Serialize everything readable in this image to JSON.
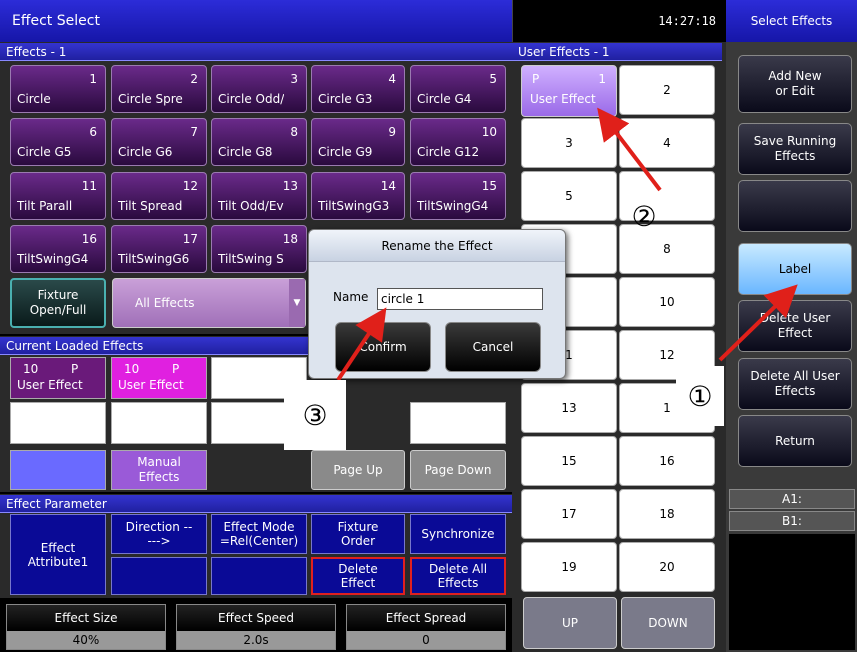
{
  "header": {
    "title": "Effect Select",
    "clock": "14:27:18",
    "mode": "Select Effects"
  },
  "effects_panel": {
    "title": "Effects - 1",
    "items": [
      {
        "num": "1",
        "name": "Circle"
      },
      {
        "num": "2",
        "name": "Circle Spre"
      },
      {
        "num": "3",
        "name": "Circle Odd/"
      },
      {
        "num": "4",
        "name": "Circle G3"
      },
      {
        "num": "5",
        "name": "Circle G4"
      },
      {
        "num": "6",
        "name": "Circle G5"
      },
      {
        "num": "7",
        "name": "Circle G6"
      },
      {
        "num": "8",
        "name": "Circle G8"
      },
      {
        "num": "9",
        "name": "Circle G9"
      },
      {
        "num": "10",
        "name": "Circle G12"
      },
      {
        "num": "11",
        "name": "Tilt Parall"
      },
      {
        "num": "12",
        "name": "Tilt Spread"
      },
      {
        "num": "13",
        "name": "Tilt Odd/Ev"
      },
      {
        "num": "14",
        "name": "TiltSwingG3"
      },
      {
        "num": "15",
        "name": "TiltSwingG4"
      },
      {
        "num": "16",
        "name": "TiltSwingG4"
      },
      {
        "num": "17",
        "name": "TiltSwingG6"
      },
      {
        "num": "18",
        "name": "TiltSwing S"
      }
    ],
    "fixture_btn": "Fixture Open/Full",
    "filter_value": "All Effects"
  },
  "loaded_panel": {
    "title": "Current Loaded Effects",
    "cells": [
      {
        "num": "10",
        "tag": "P",
        "name": "User Effect"
      },
      {
        "num": "10",
        "tag": "P",
        "name": "User Effect"
      }
    ],
    "manual_label": "Manual Effects",
    "page_up": "Page Up",
    "page_down": "Page Down"
  },
  "param_panel": {
    "title": "Effect Parameter",
    "attribute": "Effect Attribute1",
    "direction": "Direction ----->",
    "mode": "Effect Mode =Rel(Center)",
    "order": "Fixture Order",
    "sync": "Synchronize",
    "delete": "Delete Effect",
    "delete_all": "Delete All Effects"
  },
  "bottom": [
    {
      "label": "Effect Size",
      "value": "40%"
    },
    {
      "label": "Effect Speed",
      "value": "2.0s"
    },
    {
      "label": "Effect Spread",
      "value": "0"
    }
  ],
  "user_effects": {
    "title": "User Effects - 1",
    "first": {
      "tag": "P",
      "num": "1",
      "name": "User Effect"
    },
    "cells": [
      "2",
      "3",
      "4",
      "5",
      "",
      "",
      "8",
      "",
      "10",
      "1",
      "12",
      "13",
      "1",
      "15",
      "16",
      "17",
      "18",
      "19",
      "20"
    ],
    "up": "UP",
    "down": "DOWN"
  },
  "sidebar": {
    "buttons": [
      "Add New or Edit",
      "Save Running Effects",
      "",
      "Label",
      "Delete User Effect",
      "Delete All User Effects",
      "Return"
    ],
    "a1": "A1:",
    "b1": "B1:"
  },
  "dialog": {
    "title": "Rename the Effect",
    "name_label": "Name",
    "name_value": "circle 1",
    "confirm": "Confirm",
    "cancel": "Cancel"
  },
  "annotations": [
    "①",
    "②",
    "③"
  ],
  "colors": {
    "accent_red": "#e0201a",
    "title_blue": "#1a1ab8",
    "effect_purple": "#4a1a6a",
    "active_blue": "#6ab6ff"
  }
}
